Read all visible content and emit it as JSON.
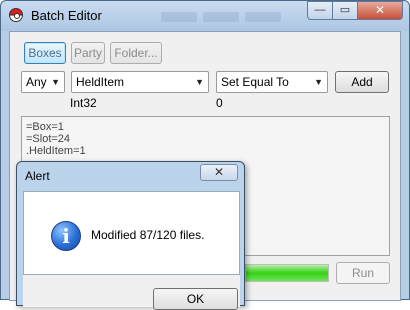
{
  "window": {
    "title": "Batch Editor",
    "minimize": "—",
    "maximize": "▭",
    "close": "✕"
  },
  "tabs": [
    {
      "label": "Boxes"
    },
    {
      "label": "Party"
    },
    {
      "label": "Folder..."
    }
  ],
  "filter": {
    "selection": "Any",
    "property": "HeldItem",
    "operation": "Set Equal To",
    "add_label": "Add"
  },
  "property_info": {
    "type": "Int32",
    "value": "0"
  },
  "script": {
    "lines": [
      "=Box=1",
      "=Slot=24",
      ".HeldItem=1"
    ]
  },
  "run_label": "Run",
  "progress": {
    "percent": 100
  },
  "alert": {
    "title": "Alert",
    "close": "✕",
    "message": "Modified 87/120 files.",
    "ok_label": "OK",
    "icon_glyph": "i"
  },
  "colors": {
    "titlebar": "#b7cde6",
    "progress_fill": "#37d014",
    "info_icon": "#2b6fd6",
    "selected_tab": "#bee6fd"
  }
}
